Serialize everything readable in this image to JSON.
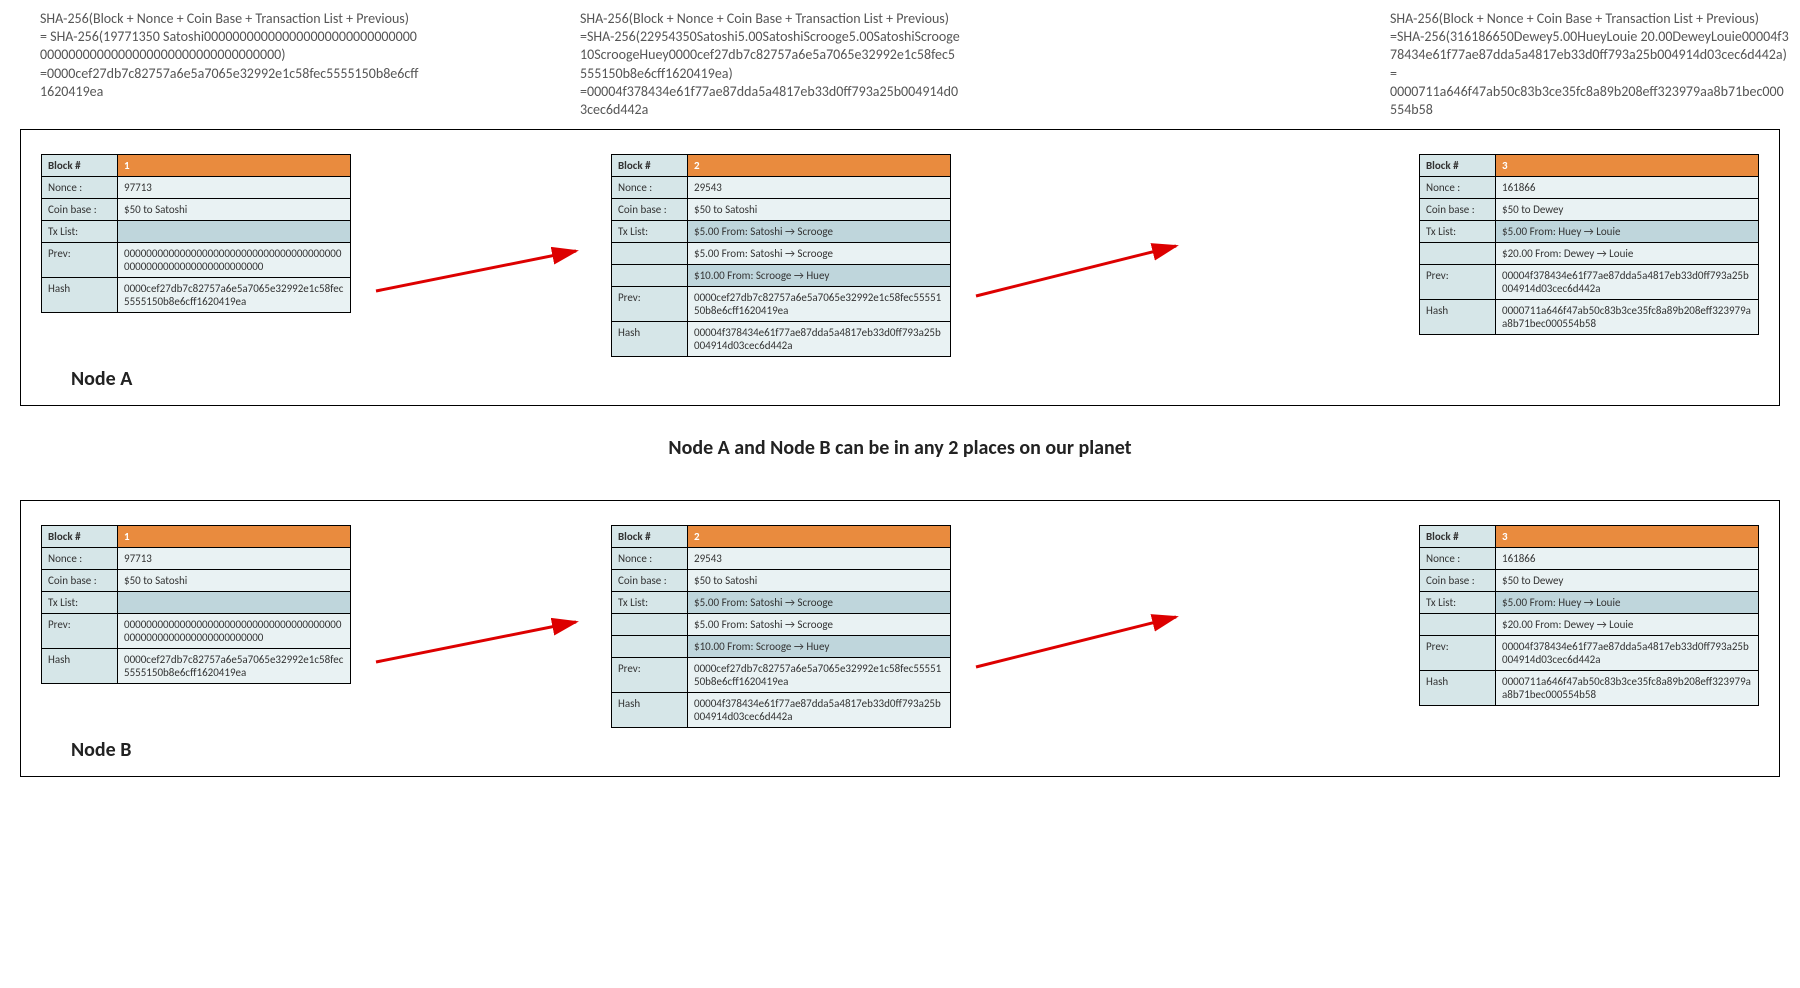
{
  "sha": {
    "s1_l1": "SHA-256(Block + Nonce + Coin Base + Transaction List + Previous)",
    "s1_l2": "= SHA-256(19771350 Satoshi0000000000000000000000000000000000000000000000000000000000000000)",
    "s1_l3": "=0000cef27db7c82757a6e5a7065e32992e1c58fec5555150b8e6cff1620419ea",
    "s2_l1": "SHA-256(Block + Nonce + Coin Base + Transaction List + Previous)",
    "s2_l2": "=SHA-256(22954350Satoshi5.00SatoshiScrooge5.00SatoshiScrooge10ScroogeHuey0000cef27db7c82757a6e5a7065e32992e1c58fec5555150b8e6cff1620419ea)",
    "s2_l3": "=00004f378434e61f77ae87dda5a4817eb33d0ff793a25b004914d03cec6d442a",
    "s3_l1": "SHA-256(Block + Nonce + Coin Base + Transaction List + Previous)",
    "s3_l2": "=SHA-256(316186650Dewey5.00HueyLouie 20.00DeweyLouie00004f378434e61f77ae87dda5a4817eb33d0ff793a25b004914d03cec6d442a) =",
    "s3_l3": "0000711a646f47ab50c83b3ce35fc8a89b208eff323979aa8b71bec000554b58"
  },
  "labels": {
    "blocknum": "Block #",
    "nonce": "Nonce :",
    "coinbase": "Coin base :",
    "txlist": "Tx List:",
    "prev": "Prev:",
    "hash": "Hash"
  },
  "b1": {
    "num": "1",
    "nonce": "97713",
    "coinbase": "$50 to Satoshi",
    "prev": "0000000000000000000000000000000000000000000000000000000000000000",
    "hash": "0000cef27db7c82757a6e5a7065e32992e1c58fec5555150b8e6cff1620419ea"
  },
  "b2": {
    "num": "2",
    "nonce": "29543",
    "coinbase": "$50 to Satoshi",
    "tx1": "$5.00 From: Satoshi → Scrooge",
    "tx2": "$5.00 From: Satoshi → Scrooge",
    "tx3": "$10.00 From: Scrooge → Huey",
    "prev": "0000cef27db7c82757a6e5a7065e32992e1c58fec5555150b8e6cff1620419ea",
    "hash": "00004f378434e61f77ae87dda5a4817eb33d0ff793a25b004914d03cec6d442a"
  },
  "b3": {
    "num": "3",
    "nonce": "161866",
    "coinbase": "$50 to Dewey",
    "tx1": "$5.00 From: Huey → Louie",
    "tx2": "$20.00 From: Dewey → Louie",
    "prev": "00004f378434e61f77ae87dda5a4817eb33d0ff793a25b004914d03cec6d442a",
    "hash": "0000711a646f47ab50c83b3ce35fc8a89b208eff323979aa8b71bec000554b58"
  },
  "nodeA": "Node A",
  "nodeB": "Node B",
  "midCaption": "Node A and Node B can be in any 2 places on our planet"
}
